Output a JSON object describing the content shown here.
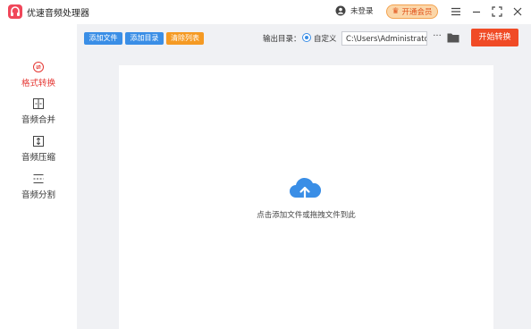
{
  "app": {
    "title": "优速音频处理器"
  },
  "header": {
    "login_label": "未登录",
    "vip_label": "开通会员",
    "icons": [
      "user-icon",
      "crown-icon",
      "menu-icon",
      "minimize-icon",
      "maximize-icon",
      "close-icon"
    ]
  },
  "sidebar": {
    "items": [
      {
        "label": "格式转换",
        "icon": "format-convert-icon",
        "active": true
      },
      {
        "label": "音频合并",
        "icon": "audio-merge-icon",
        "active": false
      },
      {
        "label": "音频压缩",
        "icon": "audio-compress-icon",
        "active": false
      },
      {
        "label": "音频分割",
        "icon": "audio-split-icon",
        "active": false
      }
    ]
  },
  "toolbar": {
    "add_file": "添加文件",
    "add_folder": "添加目录",
    "clear_list": "清除列表",
    "output_label": "输出目录：",
    "custom_option": "自定义",
    "output_path": "C:\\Users\\Administrator\\",
    "more": "···",
    "start": "开始转换"
  },
  "dropzone": {
    "hint": "点击添加文件或拖拽文件到此"
  },
  "colors": {
    "accent_blue": "#3a8ee6",
    "accent_orange": "#f59a23",
    "start_red": "#f04b26",
    "active_red": "#e53935",
    "logo_pink": "#f0475a",
    "panel_gray": "#f0f1f4"
  }
}
